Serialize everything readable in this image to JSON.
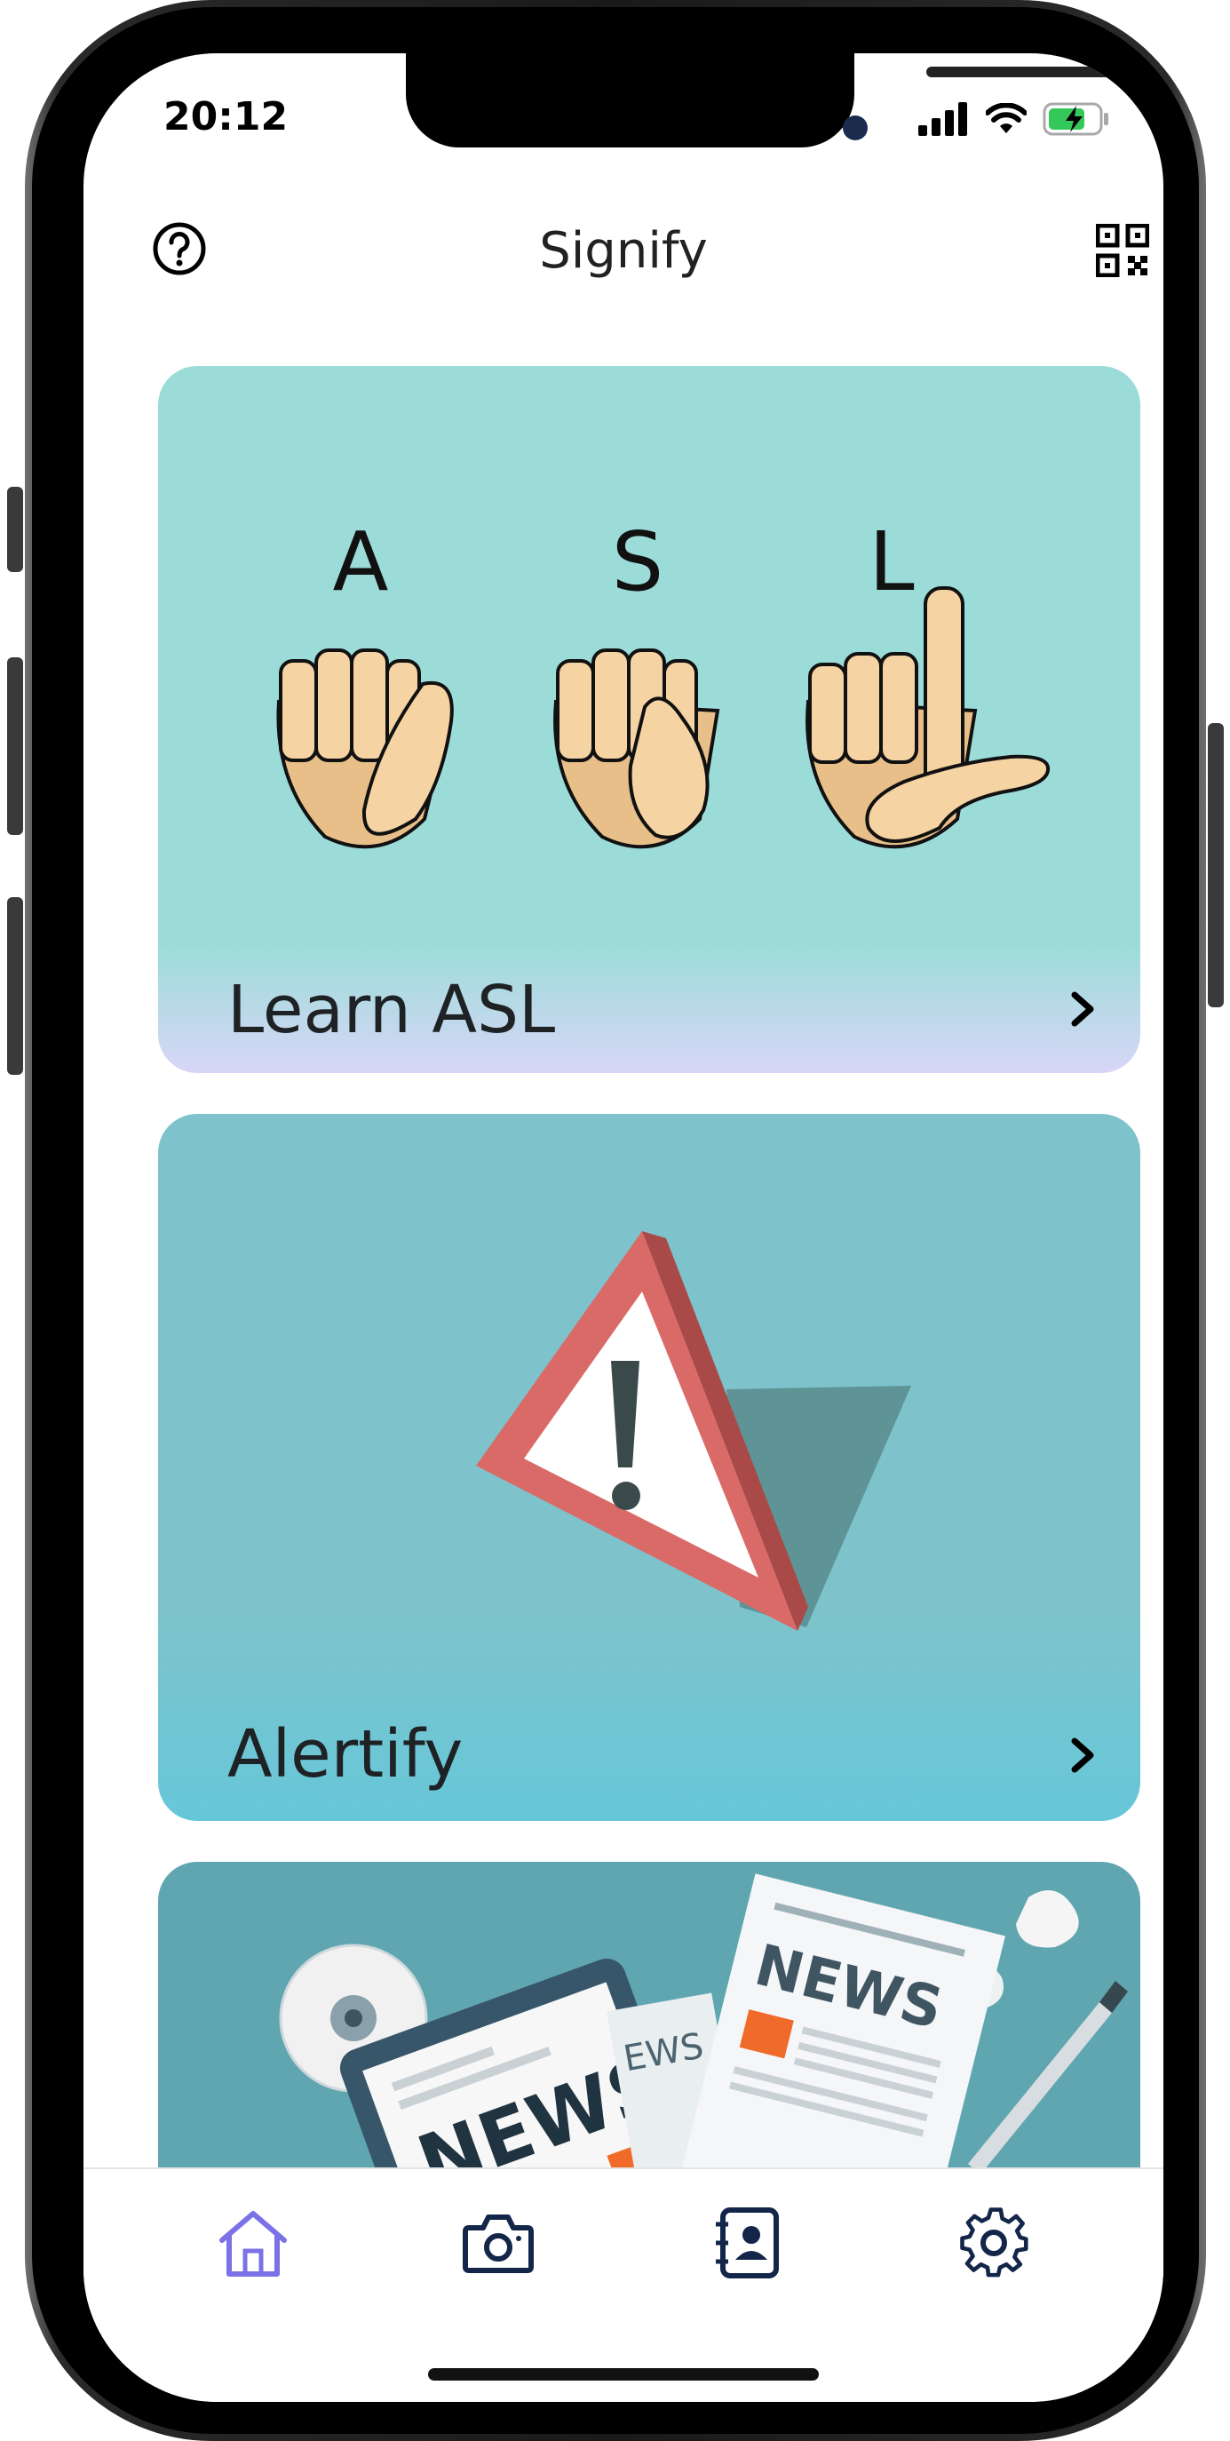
{
  "status_bar": {
    "time": "20:12"
  },
  "header": {
    "title": "Signify"
  },
  "cards": {
    "asl": {
      "letters": [
        "A",
        "S",
        "L"
      ],
      "label": "Learn ASL"
    },
    "alertify": {
      "label": "Alertify"
    },
    "news": {
      "paper_big": "NEWS",
      "paper_small": "EWS",
      "paper_front": "NEWS"
    }
  },
  "tabs": [
    {
      "icon": "home-icon",
      "active": true
    },
    {
      "icon": "camera-icon",
      "active": false
    },
    {
      "icon": "contacts-book-icon",
      "active": false
    },
    {
      "icon": "gear-icon",
      "active": false
    }
  ],
  "colors": {
    "asl_card": "#9cdcd8",
    "asl_card_bottom": "#d8d6f8",
    "alert_card": "#7ec3cb",
    "alert_card_bottom": "#66c7d9",
    "news_card": "#5fa6b1",
    "tab_active": "#7a72e6",
    "tab_inactive": "#13264a"
  }
}
